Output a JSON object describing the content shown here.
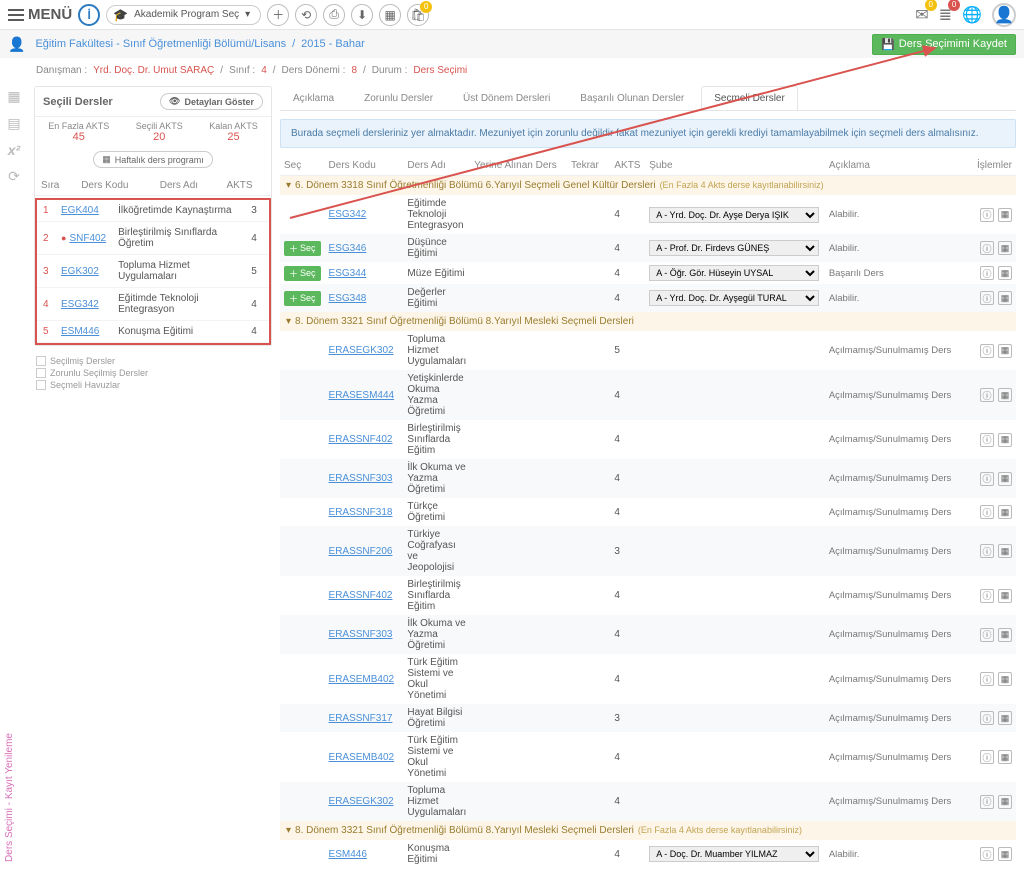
{
  "topbar": {
    "menu_label": "MENÜ",
    "logo_letter": "İ",
    "program_label": "Akademik Program Seç"
  },
  "breadcrumb": {
    "part1": "Eğitim Fakültesi - Sınıf Öğretmenliği Bölümü/Lisans",
    "part2": "2015 - Bahar"
  },
  "infobar": {
    "advisor_label": "Danışman :",
    "advisor_value": "Yrd. Doç. Dr. Umut SARAÇ",
    "class_label": "Sınıf :",
    "class_value": "4",
    "term_label": "Ders Dönemi :",
    "term_value": "8",
    "status_label": "Durum :",
    "status_value": "Ders Seçimi"
  },
  "save_button": "Ders Seçimimi Kaydet",
  "left": {
    "title": "Seçili Dersler",
    "detail_btn": "Detayları Göster",
    "max_akts_label": "En Fazla AKTS",
    "max_akts_value": "45",
    "sel_akts_label": "Seçili AKTS",
    "sel_akts_value": "20",
    "rem_akts_label": "Kalan AKTS",
    "rem_akts_value": "25",
    "week_btn": "Haftalık ders programı",
    "cols": {
      "sira": "Sıra",
      "kod": "Ders Kodu",
      "ad": "Ders Adı",
      "akts": "AKTS"
    },
    "rows": [
      {
        "i": "1",
        "code": "EGK404",
        "name": "İlköğretimde Kaynaştırma",
        "akts": "3",
        "warn": false
      },
      {
        "i": "2",
        "code": "SNF402",
        "name": "Birleştirilmiş Sınıflarda Öğretim",
        "akts": "4",
        "warn": true
      },
      {
        "i": "3",
        "code": "EGK302",
        "name": "Topluma Hizmet Uygulamaları",
        "akts": "5",
        "warn": false
      },
      {
        "i": "4",
        "code": "ESG342",
        "name": "Eğitimde Teknoloji Entegrasyon",
        "akts": "4",
        "warn": false
      },
      {
        "i": "5",
        "code": "ESM446",
        "name": "Konuşma Eğitimi",
        "akts": "4",
        "warn": false
      }
    ],
    "legend": {
      "a": "Seçilmiş Dersler",
      "b": "Zorunlu Seçilmiş Dersler",
      "c": "Seçmeli Havuzlar"
    }
  },
  "tabs": {
    "t1": "Açıklama",
    "t2": "Zorunlu Dersler",
    "t3": "Üst Dönem Dersleri",
    "t4": "Başarılı Olunan Dersler",
    "t5": "Seçmeli Dersler"
  },
  "note": "Burada seçmeli dersleriniz yer almaktadır. Mezuniyet için zorunlu değildir fakat mezuniyet için gerekli krediyi tamamlayabilmek için seçmeli ders almalısınız.",
  "cols": {
    "sec": "Seç",
    "kod": "Ders Kodu",
    "ad": "Ders Adı",
    "yerine": "Yerine Alınan Ders",
    "tekrar": "Tekrar",
    "akts": "AKTS",
    "sube": "Şube",
    "acik": "Açıklama",
    "ops": "İşlemler"
  },
  "group1": {
    "title": "6. Dönem 3318 Sınıf Öğretmenliği Bölümü 6.Yarıyıl Seçmeli Genel Kültür Dersleri",
    "sub": "(En Fazla 4 Akts derse kayıtlanabilirsiniz)"
  },
  "group2": {
    "title": "8. Dönem 3321 Sınıf Öğretmenliği Bölümü 8.Yarıyıl Mesleki Seçmeli Dersleri"
  },
  "group3": {
    "title": "8. Dönem 3321 Sınıf Öğretmenliği Bölümü 8.Yarıyıl Mesleki Seçmeli Dersleri",
    "sub": "(En Fazla 4 Akts derse kayıtlanabilirsiniz)"
  },
  "rows_g1": [
    {
      "code": "ESG342",
      "name": "Eğitimde Teknoloji Entegrasyon",
      "akts": "4",
      "sube": "A - Yrd. Doç. Dr. Ayşe Derya IŞIK",
      "acik": "Alabilir.",
      "sec": false
    },
    {
      "code": "ESG346",
      "name": "Düşünce Eğitimi",
      "akts": "4",
      "sube": "A - Prof. Dr. Firdevs GÜNEŞ",
      "acik": "Alabilir.",
      "sec": true
    },
    {
      "code": "ESG344",
      "name": "Müze Eğitimi",
      "akts": "4",
      "sube": "A - Öğr. Gör. Hüseyin UYSAL",
      "acik": "Başarılı Ders",
      "sec": true
    },
    {
      "code": "ESG348",
      "name": "Değerler Eğitimi",
      "akts": "4",
      "sube": "A - Yrd. Doç. Dr. Ayşegül TURAL",
      "acik": "Alabilir.",
      "sec": true
    }
  ],
  "rows_g2": [
    {
      "code": "ERASEGK302",
      "name": "Topluma Hizmet Uygulamaları",
      "akts": "5"
    },
    {
      "code": "ERASESM444",
      "name": "Yetişkinlerde Okuma Yazma Öğretimi",
      "akts": "4"
    },
    {
      "code": "ERASSNF402",
      "name": "Birleştirilmiş Sınıflarda Eğitim",
      "akts": "4"
    },
    {
      "code": "ERASSNF303",
      "name": "İlk Okuma ve Yazma Öğretimi",
      "akts": "4"
    },
    {
      "code": "ERASSNF318",
      "name": "Türkçe Öğretimi",
      "akts": "4"
    },
    {
      "code": "ERASSNF206",
      "name": "Türkiye Coğrafyası ve Jeopolojisi",
      "akts": "3"
    },
    {
      "code": "ERASSNF402",
      "name": "Birleştirilmiş Sınıflarda Eğitim",
      "akts": "4"
    },
    {
      "code": "ERASSNF303",
      "name": "İlk Okuma ve Yazma Öğretimi",
      "akts": "4"
    },
    {
      "code": "ERASEMB402",
      "name": "Türk Eğitim Sistemi ve Okul Yönetimi",
      "akts": "4"
    },
    {
      "code": "ERASSNF317",
      "name": "Hayat Bilgisi Öğretimi",
      "akts": "3"
    },
    {
      "code": "ERASEMB402",
      "name": "Türk Eğitim Sistemi ve Okul Yönetimi",
      "akts": "4"
    },
    {
      "code": "ERASEGK302",
      "name": "Topluma Hizmet Uygulamaları",
      "akts": "4"
    }
  ],
  "rows_g3": [
    {
      "code": "ESM446",
      "name": "Konuşma Eğitimi",
      "akts": "4",
      "sube": "A - Doç. Dr. Muamber YILMAZ",
      "acik": "Alabilir."
    }
  ],
  "closed_text": "Açılmamış/Sunulmamış Ders",
  "sec_btn": "Seç",
  "sidebar_vertical": "Ders Seçimi - Kayıt Yenileme"
}
